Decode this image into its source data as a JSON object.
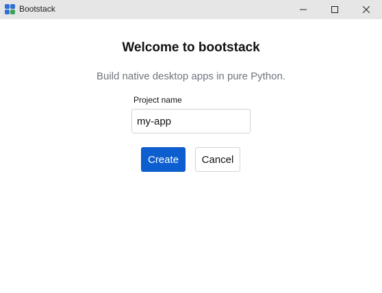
{
  "window": {
    "title": "Bootstack",
    "app_icon": "bootstack-logo-icon",
    "controls": {
      "minimize_icon": "minimize-icon",
      "maximize_icon": "maximize-icon",
      "close_icon": "close-icon"
    }
  },
  "main": {
    "heading": "Welcome to bootstack",
    "subtitle": "Build native desktop apps in pure Python.",
    "project_field": {
      "label": "Project name",
      "value": "my-app"
    },
    "buttons": {
      "create_label": "Create",
      "cancel_label": "Cancel"
    }
  },
  "colors": {
    "primary": "#0d5fd0",
    "titlebar": "#e6e6e6",
    "subtitle_text": "#6c757d",
    "icon_blue": "#2f6fd6",
    "icon_green": "#3aa15a"
  }
}
